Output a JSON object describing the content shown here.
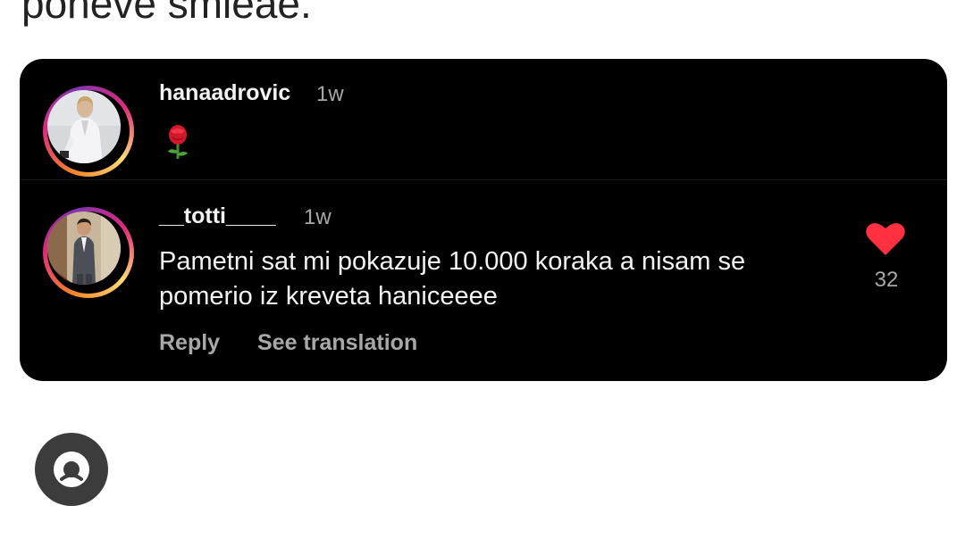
{
  "background_text": "poheve smieae.",
  "comments": [
    {
      "username": "hanaadrovic",
      "time": "1w",
      "body_icon": "rose-emoji",
      "avatar_icon": "profile-photo-woman-white-suit"
    },
    {
      "username": "__totti____",
      "time": "1w",
      "text": "Pametni sat mi pokazuje 10.000 koraka a nisam se pomerio iz kreveta haniceeee",
      "avatar_icon": "profile-photo-man-suit",
      "actions": {
        "reply": "Reply",
        "see_translation": "See translation"
      },
      "like": {
        "icon": "heart-filled-icon",
        "count": "32",
        "color": "#ff3040"
      }
    }
  ],
  "fab": {
    "icon": "face-emoji-icon"
  },
  "colors": {
    "card_background": "#000000",
    "primary_text": "#f2f2f2",
    "secondary_text": "#a8a8a8",
    "like_red": "#ff3040",
    "fab_background": "#3c3c3c"
  }
}
